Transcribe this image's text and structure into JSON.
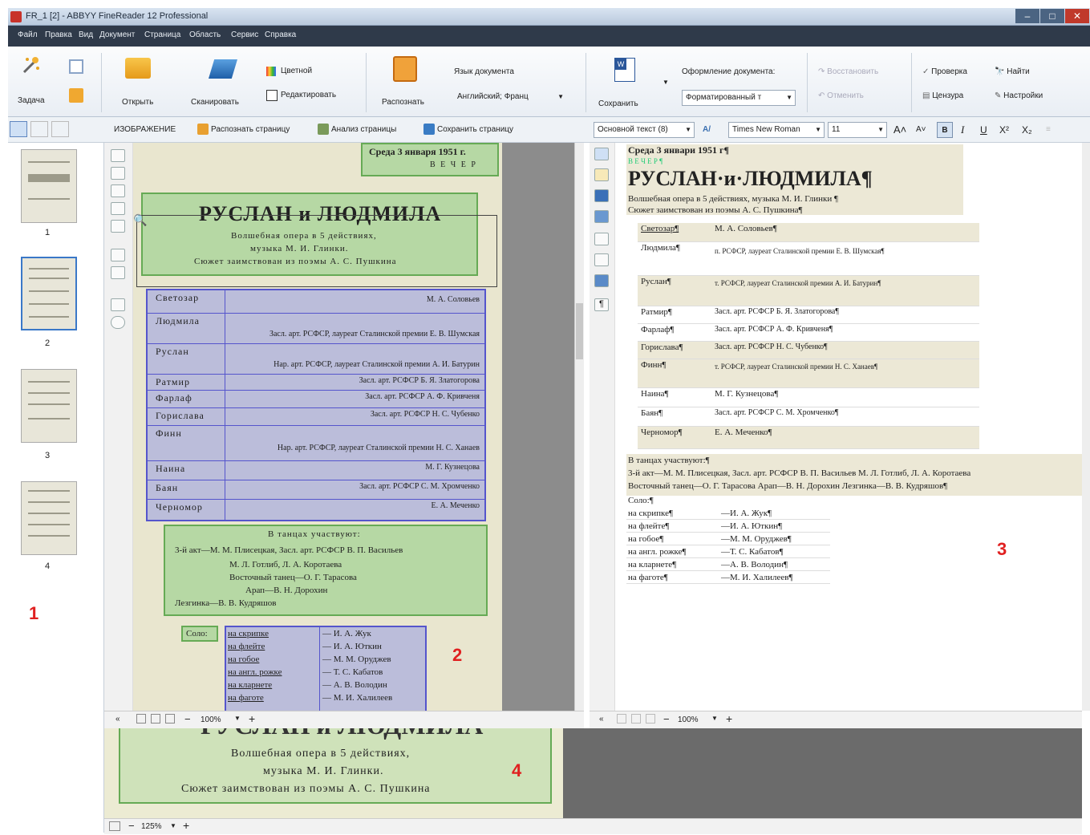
{
  "window": {
    "title": "FR_1 [2] - ABBYY FineReader 12 Professional",
    "controls": [
      "–",
      "□",
      "✕"
    ]
  },
  "menu": [
    "Файл",
    "Правка",
    "Вид",
    "Документ",
    "Страница",
    "Область",
    "Сервис",
    "Справка"
  ],
  "ribbon": {
    "task_label": "Задача",
    "open_label": "Открыть",
    "scan_label": "Сканировать",
    "color_label": "Цветной",
    "edit_label": "Редактировать",
    "recognize_label": "Распознать",
    "doc_lang_label": "Язык документа",
    "doc_lang_value": "Английский; Франц",
    "save_label": "Сохранить",
    "doc_format_label": "Оформление документа:",
    "doc_format_value": "Форматированный т",
    "restore_label": "Восстановить",
    "undo_label": "Отменить",
    "check_label": "Проверка",
    "censor_label": "Цензура",
    "find_label": "Найти",
    "settings_label": "Настройки"
  },
  "toolbar": {
    "image_label": "ИЗОБРАЖЕНИЕ",
    "recognize_page": "Распознать страницу",
    "analyze_page": "Анализ страницы",
    "save_page": "Сохранить страницу",
    "style_value": "Основной текст (8)",
    "font_value": "Times New Roman",
    "size_value": "11",
    "bold": "B",
    "italic": "I",
    "underline": "U",
    "superscript": "X²",
    "subscript": "X₂"
  },
  "pages": [
    "1",
    "2",
    "3",
    "4"
  ],
  "image_doc": {
    "date": "Среда 3 января 1951 г.",
    "evening": "В Е Ч Е Р",
    "title": "РУСЛАН и ЛЮДМИЛА",
    "sub1": "Волшебная опера в 5 действиях,",
    "sub2": "музыка М. И. Глинки.",
    "sub3": "Сюжет заимствован из поэмы А. С. Пушкина",
    "cast": [
      {
        "role": "Светозар",
        "actor": "М. А. Соловьев"
      },
      {
        "role": "Людмила",
        "actor": "Засл. арт. РСФСР, лауреат Сталинской премии Е. В. Шумская"
      },
      {
        "role": "Руслан",
        "actor": "Нар. арт. РСФСР, лауреат Сталинской премии А. И. Батурин"
      },
      {
        "role": "Ратмир",
        "actor": "Засл. арт. РСФСР Б. Я. Златогорова"
      },
      {
        "role": "Фарлаф",
        "actor": "Засл. арт. РСФСР А. Ф. Кривченя"
      },
      {
        "role": "Горислава",
        "actor": "Засл. арт. РСФСР Н. С. Чубенко"
      },
      {
        "role": "Финн",
        "actor": "Нар. арт. РСФСР, лауреат Сталинской премии Н. С. Ханаев"
      },
      {
        "role": "Наина",
        "actor": "М. Г. Кузнецова"
      },
      {
        "role": "Баян",
        "actor": "Засл. арт. РСФСР С. М. Хромченко"
      },
      {
        "role": "Черномор",
        "actor": "Е. А. Меченко"
      }
    ],
    "dances_title": "В танцах участвуют:",
    "dances": [
      "3-й акт—М. М. Плисецкая, Засл. арт. РСФСР В. П. Васильев",
      "М. Л. Готлиб, Л. А. Коротаева",
      "Восточный танец—О. Г. Тарасова",
      "Арап—В. Н. Дорохин",
      "Лезгинка—В. В. Кудряшов"
    ],
    "solo_label": "Соло:",
    "solo": [
      {
        "instr": "на скрипке",
        "player": "— И. А. Жук"
      },
      {
        "instr": "на флейте",
        "player": "— И. А. Юткин"
      },
      {
        "instr": "на гобое",
        "player": "— М. М. Оруджев"
      },
      {
        "instr": "на англ. рожке",
        "player": "— Т. С. Кабатов"
      },
      {
        "instr": "на кларнете",
        "player": "— А. В. Володин"
      },
      {
        "instr": "на фаготе",
        "player": "— М. И. Халилеев"
      }
    ]
  },
  "text_doc": {
    "date": "Среда 3 январи 1951 г¶",
    "evening": "В Е Ч Е Р ¶",
    "title": "РУСЛАН·и·ЛЮДМИЛА¶",
    "sub1": "Волшебная опера в 5 действиях, музыка М. И. Глинки ¶",
    "sub2": "Сюжет заимствован из поэмы А. С. Пушкина¶",
    "cast": [
      {
        "role": "Светозар¶",
        "actor": "М. А. Соловьев¶"
      },
      {
        "role": "Людмила¶",
        "actor": "п. РСФСР, лауреат Сталинской премии Е. В. Шумская¶"
      },
      {
        "role": "Руслан¶",
        "actor": "т. РСФСР, лауреат Сталинской премии А. И. Батурин¶"
      },
      {
        "role": "Ратмир¶",
        "actor": "Засл. арт. РСФСР Б. Я. Златогорова¶"
      },
      {
        "role": "Фарлаф¶",
        "actor": "Засл. арт. РСФСР А. Ф. Кривченя¶"
      },
      {
        "role": "Горислава¶",
        "actor": "Засл. арт. РСФСР Н. С. Чубенко¶"
      },
      {
        "role": "Финн¶",
        "actor": "т. РСФСР, лауреат Сталинской премии Н. С. Ханаев¶"
      },
      {
        "role": "Наина¶",
        "actor": "М. Г. Кузнецова¶"
      },
      {
        "role": "Баян¶",
        "actor": "Засл. арт. РСФСР С. М. Хромченко¶"
      },
      {
        "role": "Черномор¶",
        "actor": "Е. А. Меченко¶"
      }
    ],
    "dances1": "В танцах участвуют:¶",
    "dances2": "3-й акт—М. М. Плисецкая, Засл. арт. РСФСР В. П. Васильев М. Л. Готлиб, Л. А. Коротаева",
    "dances3": "Восточный танец—О. Г. Тарасова Арап—В. Н. Дорохин Лезгинка—В. В. Кудряшов¶",
    "solo_label": "Соло:¶",
    "solo": [
      {
        "instr": "на скрипке¶",
        "player": "—И. А. Жук¶"
      },
      {
        "instr": "на флейте¶",
        "player": "—И. А. Юткин¶"
      },
      {
        "instr": "на гобое¶",
        "player": "—М. М. Оруджев¶"
      },
      {
        "instr": "на англ. рожке¶",
        "player": "—Т. С. Кабатов¶"
      },
      {
        "instr": "на кларнете¶",
        "player": "—А. В. Володин¶"
      },
      {
        "instr": "на фаготе¶",
        "player": "—М. И. Халилеев¶"
      }
    ]
  },
  "zoom": {
    "image_pane": "100%",
    "text_pane": "100%",
    "zoom_pane": "125%",
    "zoom_sub1": "Волшебная опера в 5 действиях,",
    "zoom_sub2": "музыка М. И. Глинки.",
    "zoom_sub3": "Сюжет заимствован из поэмы А. С. Пушкина",
    "zoom_title_partial": "РУСЛАН и ЛЮДМИЛА"
  },
  "annotations": [
    "1",
    "2",
    "3",
    "4"
  ],
  "colors": {
    "green_block": "#78c86e",
    "blue_block": "#828ce6",
    "annotation_red": "#e02020",
    "menu_bar": "#2f3a4a",
    "selection_blue": "#3a78c8"
  }
}
